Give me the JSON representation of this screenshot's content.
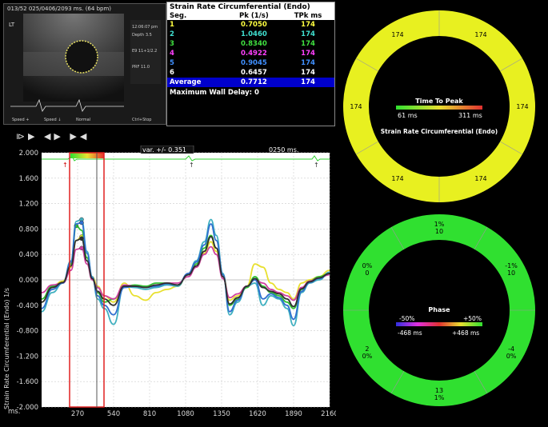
{
  "ultrasound": {
    "header": "013/52  025/0406/2093 ms.  (64 bpm)",
    "lt": "LT",
    "footer": [
      "Speed +",
      "Speed ↓",
      "Normal",
      "Ctrl+Stop"
    ]
  },
  "table": {
    "title": "Strain Rate Circumferential (Endo)",
    "col_seg": "Seg.",
    "col_pk": "Pk (1/s)",
    "col_tpk": "TPk ms",
    "rows": [
      {
        "seg": "1",
        "pk": "0.7050",
        "tpk": "174",
        "color": "#ffff40"
      },
      {
        "seg": "2",
        "pk": "1.0460",
        "tpk": "174",
        "color": "#40e0d0"
      },
      {
        "seg": "3",
        "pk": "0.8340",
        "tpk": "174",
        "color": "#40e040"
      },
      {
        "seg": "4",
        "pk": "0.4922",
        "tpk": "174",
        "color": "#ff40ff"
      },
      {
        "seg": "5",
        "pk": "0.9045",
        "tpk": "174",
        "color": "#4090ff"
      },
      {
        "seg": "6",
        "pk": "0.6457",
        "tpk": "174",
        "color": "#ffffff"
      }
    ],
    "average_label": "Average",
    "average_pk": "0.7712",
    "average_tpk": "174",
    "max_wall_delay": "Maximum Wall Delay: 0"
  },
  "controls": "⧐▶ ◀▶ ▶◀",
  "chart_data": {
    "type": "line",
    "ylabel": "Strain Rate Circumferential (Endo)  1/s",
    "xlabel": "ms.",
    "variance_label": "var. +/- 0.351",
    "time_label": "0250 ms.",
    "ylim": [
      -2.0,
      2.0
    ],
    "xlim": [
      0,
      2160
    ],
    "y_ticks": [
      "2.000",
      "1.600",
      "1.200",
      "0.800",
      "0.400",
      "0.000",
      "-0.400",
      "-0.800",
      "-1.200",
      "-1.600",
      "-2.000"
    ],
    "x_ticks": [
      "270",
      "540",
      "810",
      "1080",
      "1350",
      "1620",
      "1890",
      "2160"
    ],
    "x": [
      0,
      80,
      160,
      220,
      260,
      300,
      340,
      380,
      420,
      470,
      540,
      620,
      700,
      780,
      860,
      940,
      1020,
      1100,
      1160,
      1220,
      1270,
      1310,
      1360,
      1410,
      1470,
      1540,
      1600,
      1660,
      1720,
      1780,
      1840,
      1890,
      1950,
      2010,
      2080,
      2160
    ],
    "series": [
      {
        "color": "#e8e030",
        "values": [
          -0.35,
          -0.1,
          -0.02,
          0.2,
          0.62,
          0.68,
          0.35,
          0.05,
          -0.1,
          -0.25,
          -0.35,
          -0.05,
          -0.25,
          -0.32,
          -0.2,
          -0.15,
          -0.1,
          0.1,
          0.2,
          0.42,
          0.6,
          0.45,
          0.05,
          -0.32,
          -0.25,
          -0.1,
          0.25,
          0.2,
          -0.05,
          -0.15,
          -0.2,
          -0.3,
          -0.05,
          0.0,
          0.05,
          0.15
        ]
      },
      {
        "color": "#40b0c0",
        "values": [
          -0.5,
          -0.2,
          -0.05,
          0.3,
          0.92,
          0.95,
          0.45,
          0.05,
          -0.3,
          -0.45,
          -0.7,
          -0.1,
          -0.12,
          -0.15,
          -0.12,
          -0.08,
          -0.1,
          0.1,
          0.3,
          0.6,
          0.95,
          0.7,
          0.1,
          -0.55,
          -0.35,
          -0.1,
          -0.05,
          -0.4,
          -0.25,
          -0.3,
          -0.45,
          -0.72,
          -0.2,
          -0.05,
          0.0,
          0.12
        ]
      },
      {
        "color": "#30c030",
        "values": [
          -0.3,
          -0.1,
          -0.05,
          0.25,
          0.85,
          0.78,
          0.35,
          0.02,
          -0.2,
          -0.35,
          -0.3,
          -0.1,
          -0.08,
          -0.1,
          -0.05,
          -0.05,
          -0.08,
          0.08,
          0.25,
          0.5,
          0.7,
          0.5,
          0.05,
          -0.4,
          -0.3,
          -0.12,
          0.05,
          -0.1,
          -0.2,
          -0.25,
          -0.35,
          -0.45,
          -0.15,
          -0.02,
          0.05,
          0.1
        ]
      },
      {
        "color": "#d040a0",
        "values": [
          -0.2,
          -0.08,
          -0.05,
          0.15,
          0.48,
          0.5,
          0.25,
          0.0,
          -0.12,
          -0.25,
          -0.3,
          -0.08,
          -0.1,
          -0.12,
          -0.08,
          -0.05,
          -0.05,
          0.05,
          0.2,
          0.4,
          0.52,
          0.4,
          0.02,
          -0.28,
          -0.22,
          -0.1,
          0.0,
          -0.05,
          -0.15,
          -0.2,
          -0.25,
          -0.32,
          -0.12,
          -0.02,
          0.03,
          0.08
        ]
      },
      {
        "color": "#3070d0",
        "values": [
          -0.45,
          -0.15,
          -0.05,
          0.28,
          0.88,
          0.9,
          0.42,
          0.04,
          -0.25,
          -0.4,
          -0.55,
          -0.12,
          -0.1,
          -0.12,
          -0.1,
          -0.06,
          -0.08,
          0.1,
          0.28,
          0.55,
          0.88,
          0.62,
          0.08,
          -0.5,
          -0.32,
          -0.1,
          0.0,
          -0.3,
          -0.22,
          -0.28,
          -0.4,
          -0.62,
          -0.18,
          -0.04,
          0.02,
          0.1
        ]
      },
      {
        "color": "#303030",
        "values": [
          -0.35,
          -0.12,
          -0.04,
          0.22,
          0.62,
          0.65,
          0.3,
          0.02,
          -0.18,
          -0.3,
          -0.4,
          -0.1,
          -0.1,
          -0.12,
          -0.08,
          -0.05,
          -0.08,
          0.08,
          0.22,
          0.45,
          0.68,
          0.5,
          0.05,
          -0.38,
          -0.28,
          -0.1,
          0.02,
          -0.12,
          -0.18,
          -0.22,
          -0.3,
          -0.42,
          -0.14,
          -0.03,
          0.03,
          0.1
        ]
      }
    ]
  },
  "ttp_ring": {
    "values": [
      "174",
      "174",
      "174",
      "174",
      "174",
      "174"
    ],
    "title": "Time To Peak",
    "min": "61 ms",
    "max": "311 ms",
    "subtitle": "Strain Rate Circumferential (Endo)",
    "color": "#e8f020"
  },
  "phase_ring": {
    "labels": [
      "1%\n10",
      "-1%\n10",
      "-4\n0%",
      "13\n1%",
      "2\n0%",
      "0%\n0"
    ],
    "title": "Phase",
    "min_pct": "-50%",
    "max_pct": "+50%",
    "min_ms": "-468 ms",
    "max_ms": "+468 ms",
    "color": "#30e030"
  }
}
